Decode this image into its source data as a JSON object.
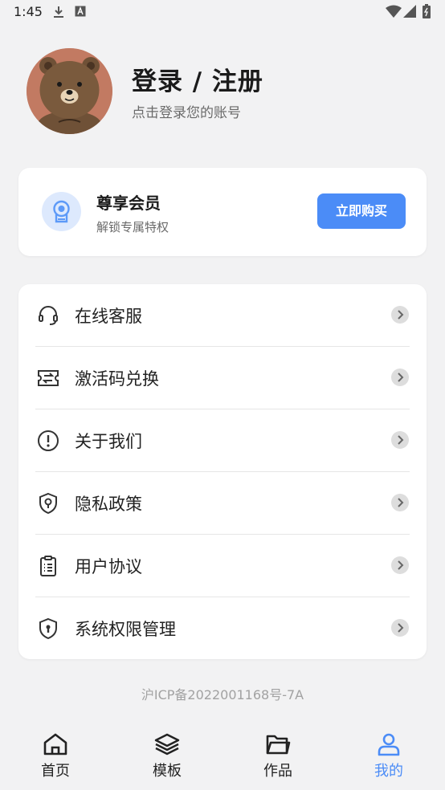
{
  "status_bar": {
    "time": "1:45"
  },
  "profile": {
    "title": "登录 / 注册",
    "subtitle": "点击登录您的账号"
  },
  "vip": {
    "title": "尊享会员",
    "subtitle": "解锁专属特权",
    "buy_label": "立即购买"
  },
  "menu": {
    "items": [
      {
        "label": "在线客服",
        "icon": "headset-icon"
      },
      {
        "label": "激活码兑换",
        "icon": "ticket-exchange-icon"
      },
      {
        "label": "关于我们",
        "icon": "info-icon"
      },
      {
        "label": "隐私政策",
        "icon": "shield-keyhole-icon"
      },
      {
        "label": "用户协议",
        "icon": "clipboard-list-icon"
      },
      {
        "label": "系统权限管理",
        "icon": "shield-lock-icon"
      }
    ]
  },
  "footer": {
    "icp": "沪ICP备2022001168号-7A"
  },
  "tabbar": {
    "active": "我的",
    "tabs": [
      {
        "label": "首页",
        "icon": "home-icon"
      },
      {
        "label": "模板",
        "icon": "layers-icon"
      },
      {
        "label": "作品",
        "icon": "folder-icon"
      },
      {
        "label": "我的",
        "icon": "user-icon"
      }
    ]
  },
  "colors": {
    "accent": "#4b8cf7",
    "background": "#f2f2f3",
    "card": "#ffffff"
  }
}
